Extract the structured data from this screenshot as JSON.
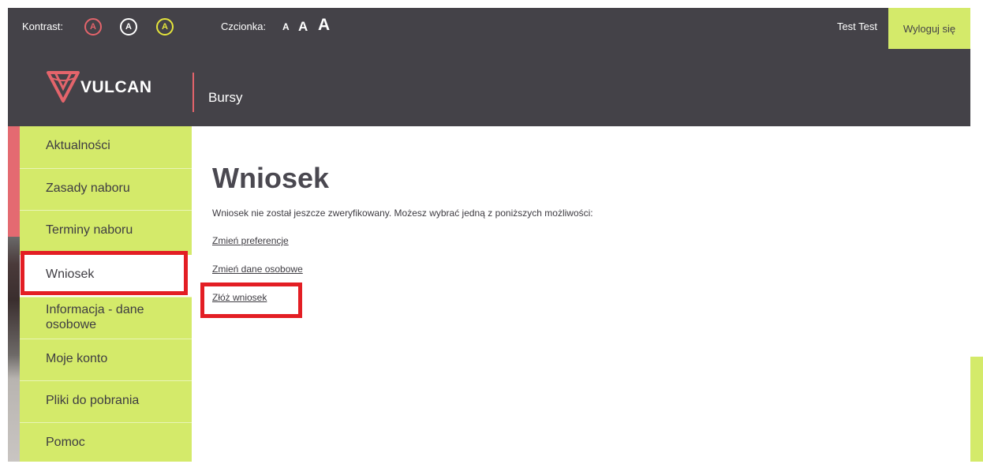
{
  "topbar": {
    "contrast_label": "Kontrast:",
    "contrast_options": [
      "A",
      "A",
      "A"
    ],
    "font_label": "Czcionka:",
    "font_sizes": [
      "A",
      "A",
      "A"
    ],
    "user_name": "Test Test",
    "logout_label": "Wyloguj się"
  },
  "header": {
    "logo_text": "VULCAN",
    "app_name": "Bursy"
  },
  "sidebar": {
    "items": [
      {
        "label": "Aktualności"
      },
      {
        "label": "Zasady naboru"
      },
      {
        "label": "Terminy naboru"
      },
      {
        "label": "Wniosek"
      },
      {
        "label": "Informacja - dane osobowe"
      },
      {
        "label": "Moje konto"
      },
      {
        "label": "Pliki do pobrania"
      },
      {
        "label": "Pomoc"
      }
    ]
  },
  "main": {
    "title": "Wniosek",
    "info": "Wniosek nie został jeszcze zweryfikowany. Możesz wybrać jedną z poniższych możliwości:",
    "links": [
      {
        "label": "Zmień preferencje"
      },
      {
        "label": "Zmień dane osobowe"
      },
      {
        "label": "Złóż wniosek"
      }
    ]
  },
  "colors": {
    "header_bg": "#444248",
    "accent_lime": "#d4ea6a",
    "accent_red": "#e4646b",
    "highlight_red": "#e31e24",
    "contrast_yellow": "#e5e53b"
  },
  "icons": [
    "vulcan-logo-icon",
    "contrast-option-icon"
  ]
}
